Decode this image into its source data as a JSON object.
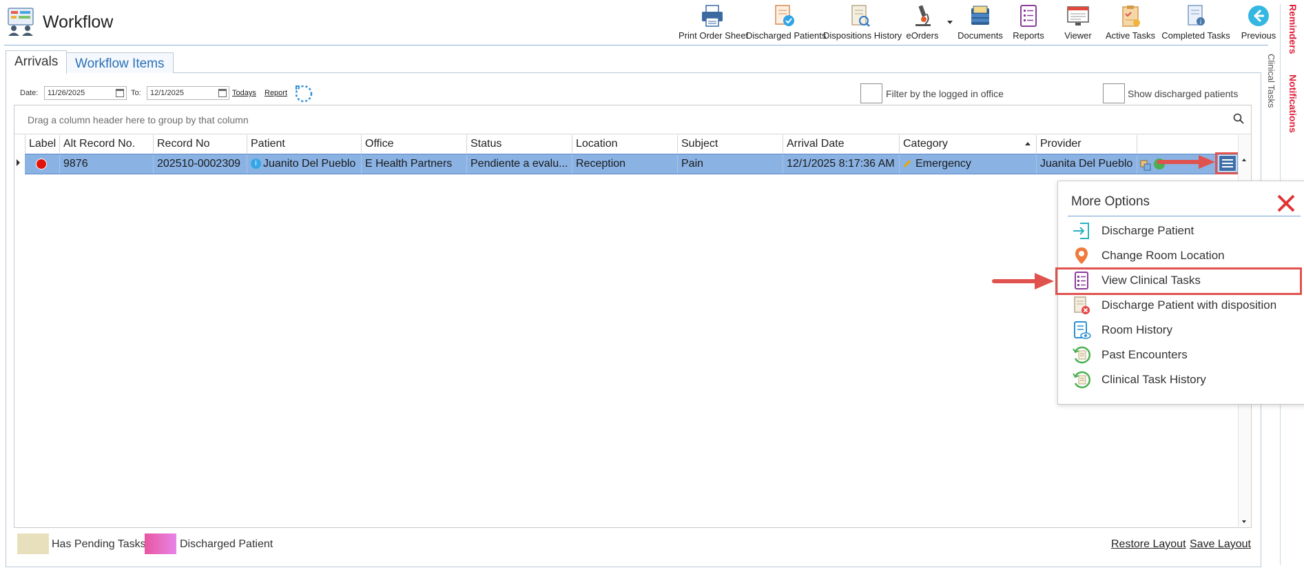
{
  "app": {
    "title": "Workflow"
  },
  "toolbar": [
    {
      "label": "Print Order Sheet",
      "icon": "printer-icon"
    },
    {
      "label": "Discharged Patients",
      "icon": "discharged-patients-icon"
    },
    {
      "label": "Dispositions History",
      "icon": "dispositions-history-icon"
    },
    {
      "label": "eOrders",
      "icon": "microscope-icon"
    },
    {
      "label": "Documents",
      "icon": "documents-icon"
    },
    {
      "label": "Reports",
      "icon": "reports-icon"
    },
    {
      "label": "Viewer",
      "icon": "viewer-icon"
    },
    {
      "label": "Active Tasks",
      "icon": "active-tasks-icon"
    },
    {
      "label": "Completed Tasks",
      "icon": "completed-tasks-icon"
    },
    {
      "label": "Previous",
      "icon": "previous-arrow-icon"
    }
  ],
  "side_rail": {
    "reminders": "Reminders",
    "notifications": "Notifications",
    "clinical_tasks": "Clinical Tasks"
  },
  "tabs": {
    "arrivals": "Arrivals",
    "workflow_items": "Workflow Items"
  },
  "filters": {
    "date_label": "Date:",
    "date_from": "11/26/2025",
    "to_label": "To:",
    "date_to": "12/1/2025",
    "todays": "Todays",
    "report": "Report",
    "filter_office": "Filter by the logged in office",
    "show_discharged": "Show discharged patients"
  },
  "grid": {
    "group_hint": "Drag a column header here to group by that column",
    "columns": [
      "Label",
      "Alt Record No.",
      "Record No",
      "Patient",
      "Office",
      "Status",
      "Location",
      "Subject",
      "Arrival Date",
      "Category",
      "Provider"
    ],
    "rows": [
      {
        "label_color": "#e3120b",
        "alt_record_no": "9876",
        "record_no": "202510-0002309",
        "patient": "Juanito Del Pueblo",
        "office": "E Health Partners",
        "status": "Pendiente a evalu...",
        "location": "Reception",
        "subject": "Pain",
        "arrival_date": "12/1/2025 8:17:36 AM",
        "category": "Emergency",
        "provider": "Juanita Del Pueblo"
      }
    ]
  },
  "more_options": {
    "title": "More Options",
    "items": [
      {
        "label": "Discharge Patient",
        "icon": "discharge-patient-icon"
      },
      {
        "label": "Change Room Location",
        "icon": "location-pin-icon"
      },
      {
        "label": "View Clinical Tasks",
        "icon": "clinical-tasks-list-icon",
        "highlighted": true
      },
      {
        "label": "Discharge Patient with disposition",
        "icon": "discharge-disposition-icon"
      },
      {
        "label": "Room History",
        "icon": "room-history-icon"
      },
      {
        "label": "Past Encounters",
        "icon": "past-encounters-icon"
      },
      {
        "label": "Clinical Task History",
        "icon": "clinical-task-history-icon"
      }
    ]
  },
  "legend": {
    "pending": {
      "label": "Has Pending Tasks",
      "color": "#e8e0bc"
    },
    "discharged": {
      "label": "Discharged Patient",
      "color": "#e866b3"
    }
  },
  "footer": {
    "restore_layout": "Restore Layout",
    "save_layout": "Save Layout"
  },
  "colors": {
    "accent": "#2a6fb8",
    "row_selected": "#8ab2e3",
    "annotation_red": "#e0524d"
  }
}
